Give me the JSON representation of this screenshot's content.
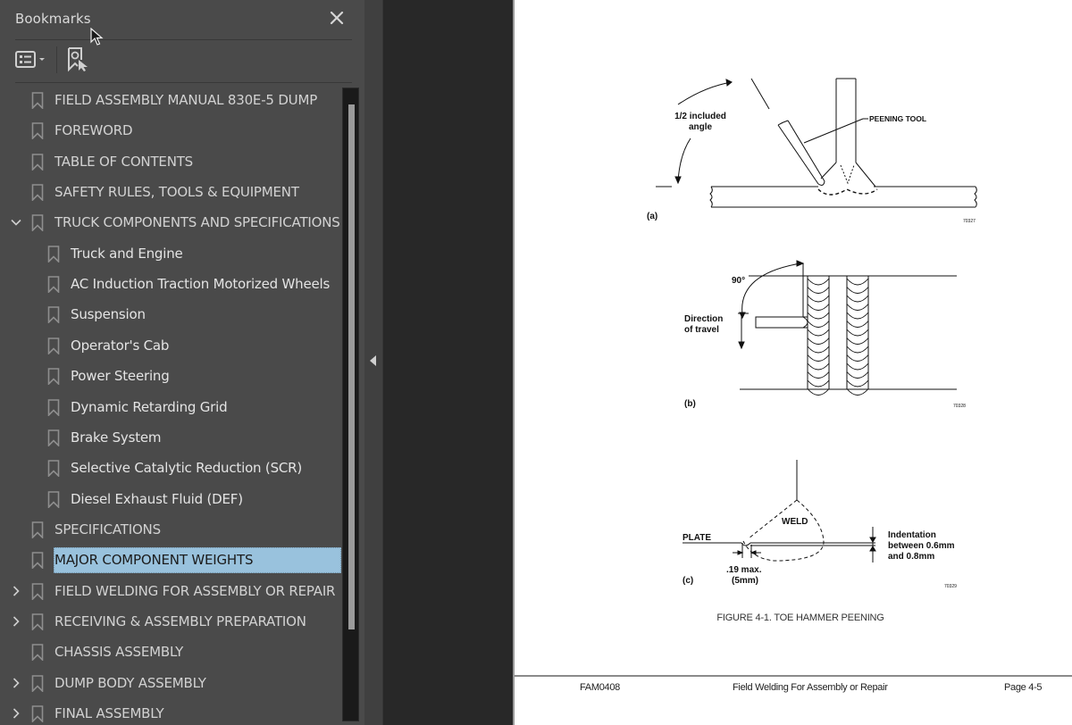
{
  "panel": {
    "title": "Bookmarks",
    "close_icon": "close-icon",
    "toolbar": [
      {
        "icon": "options-list-icon",
        "has_dropdown": true
      },
      {
        "icon": "find-current-bookmark-icon"
      }
    ]
  },
  "bookmarks": [
    {
      "label": "FIELD ASSEMBLY MANUAL 830E-5  DUMP",
      "level": 0,
      "expander": "none"
    },
    {
      "label": "FOREWORD",
      "level": 0,
      "expander": "none"
    },
    {
      "label": "TABLE OF CONTENTS",
      "level": 0,
      "expander": "none"
    },
    {
      "label": "SAFETY RULES, TOOLS & EQUIPMENT",
      "level": 0,
      "expander": "none"
    },
    {
      "label": "TRUCK COMPONENTS AND SPECIFICATIONS",
      "level": 0,
      "expander": "expanded"
    },
    {
      "label": "Truck and Engine",
      "level": 1,
      "expander": "none"
    },
    {
      "label": "AC Induction Traction Motorized Wheels",
      "level": 1,
      "expander": "none"
    },
    {
      "label": "Suspension",
      "level": 1,
      "expander": "none"
    },
    {
      "label": "Operator's Cab",
      "level": 1,
      "expander": "none"
    },
    {
      "label": "Power Steering",
      "level": 1,
      "expander": "none"
    },
    {
      "label": "Dynamic Retarding Grid",
      "level": 1,
      "expander": "none"
    },
    {
      "label": "Brake System",
      "level": 1,
      "expander": "none"
    },
    {
      "label": "Selective Catalytic Reduction (SCR)",
      "level": 1,
      "expander": "none"
    },
    {
      "label": "Diesel Exhaust Fluid (DEF)",
      "level": 1,
      "expander": "none"
    },
    {
      "label": "SPECIFICATIONS",
      "level": 0,
      "expander": "none"
    },
    {
      "label": "MAJOR COMPONENT WEIGHTS",
      "level": 0,
      "expander": "none",
      "selected": true
    },
    {
      "label": "FIELD WELDING FOR ASSEMBLY OR REPAIR",
      "level": 0,
      "expander": "collapsed"
    },
    {
      "label": "RECEIVING & ASSEMBLY PREPARATION",
      "level": 0,
      "expander": "collapsed"
    },
    {
      "label": "CHASSIS ASSEMBLY",
      "level": 0,
      "expander": "none"
    },
    {
      "label": "DUMP BODY ASSEMBLY",
      "level": 0,
      "expander": "collapsed"
    },
    {
      "label": "FINAL ASSEMBLY",
      "level": 0,
      "expander": "collapsed"
    }
  ],
  "scrollbar": {
    "visible_fraction": 0.83,
    "position_fraction": 0.0
  },
  "document": {
    "figure_a": {
      "angle_label_line1": "1/2 included",
      "angle_label_line2": "angle",
      "tool_label": "PEENING TOOL",
      "panel_label": "(a)",
      "figure_id": "70327"
    },
    "figure_b": {
      "angle_label": "90°",
      "direction_line1": "Direction",
      "direction_line2": "of travel",
      "panel_label": "(b)",
      "figure_id": "70328"
    },
    "figure_c": {
      "weld_label": "WELD",
      "plate_label": "PLATE",
      "indent_line1": "Indentation",
      "indent_line2": "between 0.6mm",
      "indent_line3": "and 0.8mm",
      "max_line1": ".19 max.",
      "max_line2": "(5mm)",
      "panel_label": "(c)",
      "figure_id": "70329"
    },
    "caption": "FIGURE 4-1. TOE HAMMER PEENING",
    "footer": {
      "doc_code": "FAM0408",
      "section": "Field Welding For Assembly or Repair",
      "page": "Page 4-5"
    }
  },
  "colors": {
    "panel_bg": "#4a4a4a",
    "selection": "#99c2dd",
    "viewer_bg": "#282828"
  }
}
